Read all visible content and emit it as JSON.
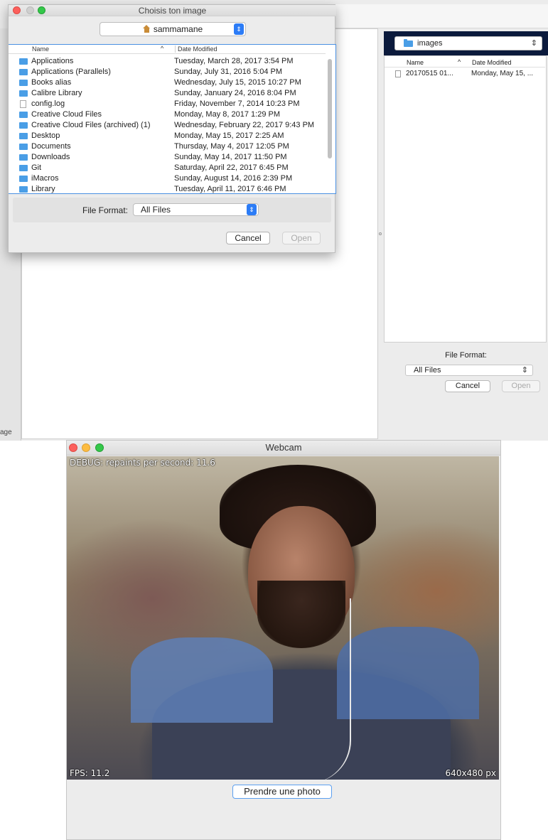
{
  "background_window": {
    "left_strip_label": "age"
  },
  "right_chooser": {
    "folder": "images",
    "col_name": "Name",
    "col_date": "Date Modified",
    "file_name": "20170515 01...",
    "file_date": "Monday, May 15, ...",
    "format_label": "File Format:",
    "format_value": "All Files",
    "cancel": "Cancel",
    "open": "Open"
  },
  "dialog": {
    "title": "Choisis ton image",
    "location": "sammamane",
    "col_name": "Name",
    "col_date": "Date Modified",
    "sort_icon": "^",
    "files": [
      {
        "name": "Applications",
        "date": "Tuesday, March 28, 2017 3:54 PM",
        "icon": "folder-icon"
      },
      {
        "name": "Applications (Parallels)",
        "date": "Sunday, July 31, 2016 5:04 PM",
        "icon": "folder-icon"
      },
      {
        "name": "Books alias",
        "date": "Wednesday, July 15, 2015 10:27 PM",
        "icon": "folder-icon"
      },
      {
        "name": "Calibre Library",
        "date": "Sunday, January 24, 2016 8:04 PM",
        "icon": "folder-icon"
      },
      {
        "name": "config.log",
        "date": "Friday, November 7, 2014 10:23 PM",
        "icon": "document-icon"
      },
      {
        "name": "Creative Cloud Files",
        "date": "Monday, May 8, 2017 1:29 PM",
        "icon": "folder-icon"
      },
      {
        "name": "Creative Cloud Files (archived) (1)",
        "date": "Wednesday, February 22, 2017 9:43 PM",
        "icon": "folder-icon"
      },
      {
        "name": "Desktop",
        "date": "Monday, May 15, 2017 2:25 AM",
        "icon": "folder-icon"
      },
      {
        "name": "Documents",
        "date": "Thursday, May 4, 2017 12:05 PM",
        "icon": "folder-icon"
      },
      {
        "name": "Downloads",
        "date": "Sunday, May 14, 2017 11:50 PM",
        "icon": "folder-icon"
      },
      {
        "name": "Git",
        "date": "Saturday, April 22, 2017 6:45 PM",
        "icon": "folder-icon"
      },
      {
        "name": "iMacros",
        "date": "Sunday, August 14, 2016 2:39 PM",
        "icon": "folder-icon"
      },
      {
        "name": "Library",
        "date": "Tuesday, April 11, 2017 6:46 PM",
        "icon": "folder-icon"
      }
    ],
    "format_label": "File Format:",
    "format_value": "All Files",
    "cancel": "Cancel",
    "open": "Open"
  },
  "webcam": {
    "title": "Webcam",
    "debug": "DEBUG: repaints per second: 11.6",
    "fps": "FPS: 11.2",
    "resolution": "640x480 px",
    "photo_button": "Prendre une photo"
  },
  "colors": {
    "close": "#fc605c",
    "minimize": "#fdbc40",
    "maximize": "#34c84a",
    "accent": "#2c7cf6",
    "folder": "#4a9ee6"
  }
}
